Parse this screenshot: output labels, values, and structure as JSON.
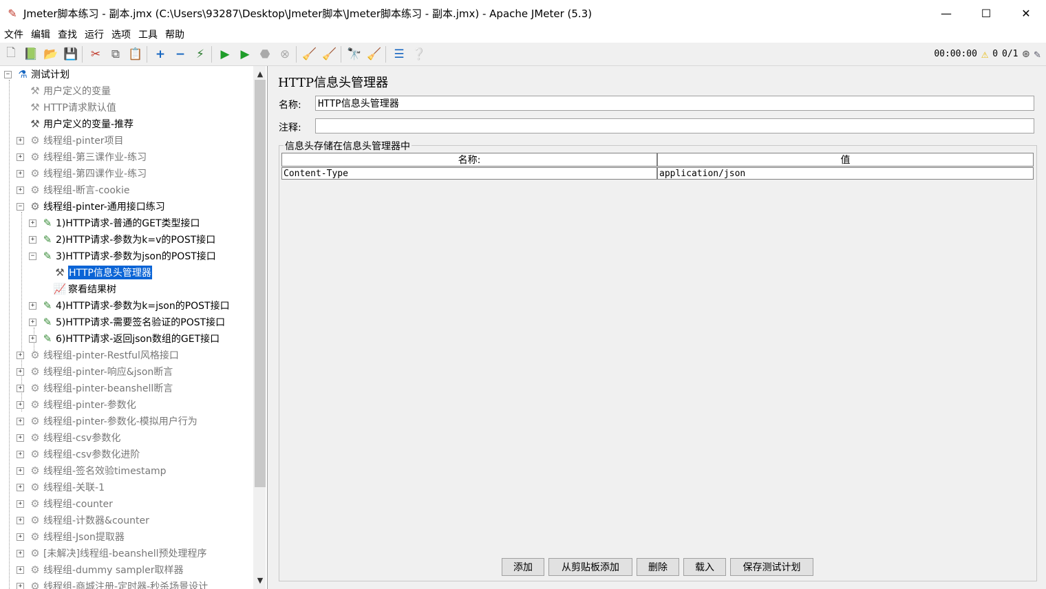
{
  "window": {
    "title": "Jmeter脚本练习 - 副本.jmx (C:\\Users\\93287\\Desktop\\Jmeter脚本\\Jmeter脚本练习 - 副本.jmx) - Apache JMeter (5.3)",
    "minimize": "—",
    "maximize": "☐",
    "close": "✕"
  },
  "menu": [
    "文件",
    "编辑",
    "查找",
    "运行",
    "选项",
    "工具",
    "帮助"
  ],
  "toolbar": {
    "elapsed": "00:00:00",
    "warnings": "0",
    "threads": "0/1"
  },
  "tree": [
    {
      "label": "测试计划",
      "level": 0,
      "expander": "−",
      "icon": "flask-icon",
      "disabled": false
    },
    {
      "label": "用户定义的变量",
      "level": 1,
      "expander": "",
      "icon": "wrench-icon",
      "disabled": true
    },
    {
      "label": "HTTP请求默认值",
      "level": 1,
      "expander": "",
      "icon": "wrench-icon",
      "disabled": true
    },
    {
      "label": "用户定义的变量-推荐",
      "level": 1,
      "expander": "",
      "icon": "wrench-icon",
      "disabled": false
    },
    {
      "label": "线程组-pinter项目",
      "level": 1,
      "expander": "+",
      "icon": "gear-icon",
      "disabled": true
    },
    {
      "label": "线程组-第三课作业-练习",
      "level": 1,
      "expander": "+",
      "icon": "gear-icon",
      "disabled": true
    },
    {
      "label": "线程组-第四课作业-练习",
      "level": 1,
      "expander": "+",
      "icon": "gear-icon",
      "disabled": true
    },
    {
      "label": "线程组-断言-cookie",
      "level": 1,
      "expander": "+",
      "icon": "gear-icon",
      "disabled": true
    },
    {
      "label": "线程组-pinter-通用接口练习",
      "level": 1,
      "expander": "−",
      "icon": "gear-icon",
      "disabled": false
    },
    {
      "label": "1)HTTP请求-普通的GET类型接口",
      "level": 2,
      "expander": "+",
      "icon": "pipette-icon",
      "disabled": false
    },
    {
      "label": "2)HTTP请求-参数为k=v的POST接口",
      "level": 2,
      "expander": "+",
      "icon": "pipette-icon",
      "disabled": false
    },
    {
      "label": "3)HTTP请求-参数为json的POST接口",
      "level": 2,
      "expander": "−",
      "icon": "pipette-icon",
      "disabled": false
    },
    {
      "label": "HTTP信息头管理器",
      "level": 3,
      "expander": "",
      "icon": "wrench-icon",
      "disabled": false,
      "selected": true
    },
    {
      "label": "察看结果树",
      "level": 3,
      "expander": "",
      "icon": "chart-icon",
      "disabled": false
    },
    {
      "label": "4)HTTP请求-参数为k=json的POST接口",
      "level": 2,
      "expander": "+",
      "icon": "pipette-icon",
      "disabled": false
    },
    {
      "label": "5)HTTP请求-需要签名验证的POST接口",
      "level": 2,
      "expander": "+",
      "icon": "pipette-icon",
      "disabled": false
    },
    {
      "label": "6)HTTP请求-返回json数组的GET接口",
      "level": 2,
      "expander": "+",
      "icon": "pipette-icon",
      "disabled": false
    },
    {
      "label": "线程组-pinter-Restful风格接口",
      "level": 1,
      "expander": "+",
      "icon": "gear-icon",
      "disabled": true
    },
    {
      "label": "线程组-pinter-响应&json断言",
      "level": 1,
      "expander": "+",
      "icon": "gear-icon",
      "disabled": true
    },
    {
      "label": "线程组-pinter-beanshell断言",
      "level": 1,
      "expander": "+",
      "icon": "gear-icon",
      "disabled": true
    },
    {
      "label": "线程组-pinter-参数化",
      "level": 1,
      "expander": "+",
      "icon": "gear-icon",
      "disabled": true
    },
    {
      "label": "线程组-pinter-参数化-模拟用户行为",
      "level": 1,
      "expander": "+",
      "icon": "gear-icon",
      "disabled": true
    },
    {
      "label": "线程组-csv参数化",
      "level": 1,
      "expander": "+",
      "icon": "gear-icon",
      "disabled": true
    },
    {
      "label": "线程组-csv参数化进阶",
      "level": 1,
      "expander": "+",
      "icon": "gear-icon",
      "disabled": true
    },
    {
      "label": "线程组-签名效验timestamp",
      "level": 1,
      "expander": "+",
      "icon": "gear-icon",
      "disabled": true
    },
    {
      "label": "线程组-关联-1",
      "level": 1,
      "expander": "+",
      "icon": "gear-icon",
      "disabled": true
    },
    {
      "label": "线程组-counter",
      "level": 1,
      "expander": "+",
      "icon": "gear-icon",
      "disabled": true
    },
    {
      "label": "线程组-计数器&counter",
      "level": 1,
      "expander": "+",
      "icon": "gear-icon",
      "disabled": true
    },
    {
      "label": "线程组-Json提取器",
      "level": 1,
      "expander": "+",
      "icon": "gear-icon",
      "disabled": true
    },
    {
      "label": "[未解决]线程组-beanshell预处理程序",
      "level": 1,
      "expander": "+",
      "icon": "gear-icon",
      "disabled": true
    },
    {
      "label": "线程组-dummy sampler取样器",
      "level": 1,
      "expander": "+",
      "icon": "gear-icon",
      "disabled": true
    },
    {
      "label": "线程组-商城注册-定时器-秒杀场景设计",
      "level": 1,
      "expander": "+",
      "icon": "gear-icon",
      "disabled": true
    }
  ],
  "panel": {
    "heading": "HTTP信息头管理器",
    "name_label": "名称:",
    "name_value": "HTTP信息头管理器",
    "comment_label": "注释:",
    "comment_value": "",
    "group_title": "信息头存储在信息头管理器中",
    "columns": [
      "名称:",
      "值"
    ],
    "rows": [
      [
        "Content-Type",
        "application/json"
      ]
    ],
    "buttons": {
      "add": "添加",
      "add_clipboard": "从剪贴板添加",
      "delete": "删除",
      "load": "载入",
      "save_plan": "保存测试计划"
    }
  }
}
